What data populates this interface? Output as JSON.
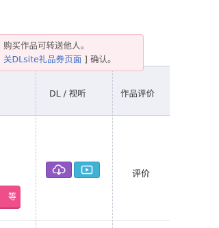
{
  "notice": {
    "line1": "购买作品可转送他人。",
    "line2_link": "关DLsite礼品券页面",
    "line2_suffix": " ] 确认。"
  },
  "table": {
    "headers": {
      "dl": "DL / 视听",
      "review": "作品评价"
    },
    "row": {
      "review_link": "评价",
      "pink_button_label": "等"
    }
  },
  "icons": {
    "download": "cloud-download-icon",
    "play": "play-icon"
  },
  "colors": {
    "notice_bg": "#fdeef2",
    "download_btn": "#8f57c2",
    "play_btn": "#3fb2d6",
    "pink_btn": "#ee4f8a",
    "header_bg": "#eef0f6"
  }
}
